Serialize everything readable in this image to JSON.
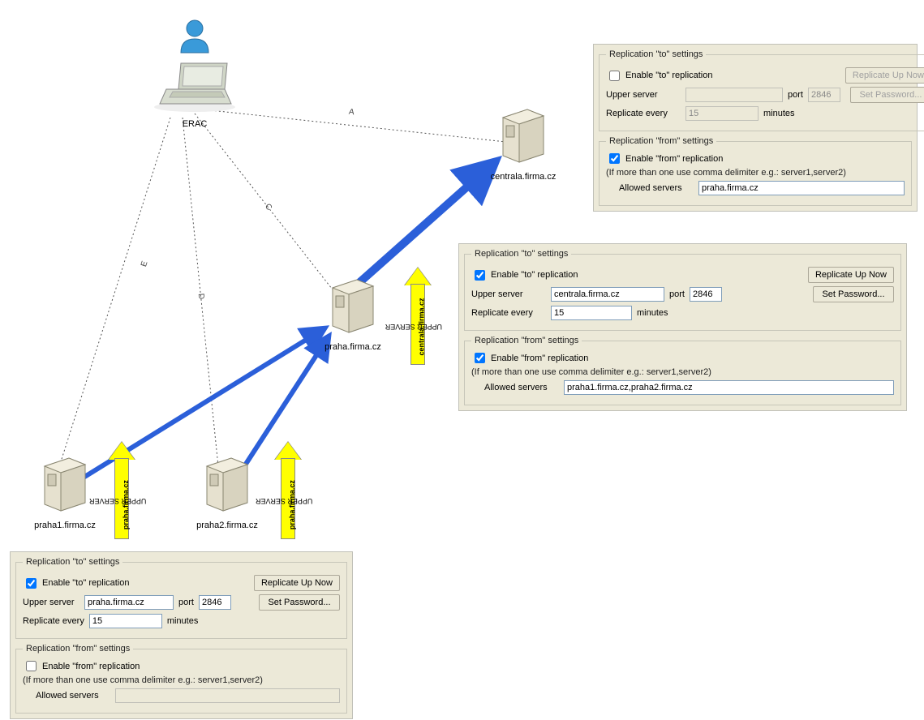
{
  "nodes": {
    "erac": {
      "label": "ERAC"
    },
    "centrala": {
      "label": "centrala.firma.cz"
    },
    "praha": {
      "label": "praha.firma.cz"
    },
    "praha1": {
      "label": "praha1.firma.cz"
    },
    "praha2": {
      "label": "praha2.firma.cz"
    }
  },
  "edgeLabels": {
    "a": "A",
    "c": "C",
    "d": "D",
    "e": "E"
  },
  "upperArrows": {
    "toCentrala": {
      "title": "UPPER SERVER",
      "target": "centrala.firma.cz"
    },
    "toPraha1": {
      "title": "UPPER SERVER",
      "target": "praha.firma.cz"
    },
    "toPraha2": {
      "title": "UPPER SERVER",
      "target": "praha.firma.cz"
    }
  },
  "panels": {
    "centrala": {
      "to": {
        "legend": "Replication \"to\" settings",
        "enableLabel": "Enable \"to\" replication",
        "enabled": false,
        "upperLabel": "Upper server",
        "upperValue": "",
        "portLabel": "port",
        "portValue": "2846",
        "everyLabel": "Replicate every",
        "everyValue": "15",
        "minutesLabel": "minutes",
        "btnReplicate": "Replicate Up Now",
        "btnPassword": "Set Password...",
        "buttonsDisabled": true,
        "inputsDisabled": true
      },
      "from": {
        "legend": "Replication \"from\" settings",
        "enableLabel": "Enable \"from\" replication",
        "enabled": true,
        "hint": "(If more than one use comma delimiter e.g.: server1,server2)",
        "allowedLabel": "Allowed servers",
        "allowedValue": "praha.firma.cz"
      }
    },
    "praha": {
      "to": {
        "legend": "Replication \"to\" settings",
        "enableLabel": "Enable \"to\" replication",
        "enabled": true,
        "upperLabel": "Upper server",
        "upperValue": "centrala.firma.cz",
        "portLabel": "port",
        "portValue": "2846",
        "everyLabel": "Replicate every",
        "everyValue": "15",
        "minutesLabel": "minutes",
        "btnReplicate": "Replicate Up Now",
        "btnPassword": "Set Password...",
        "buttonsDisabled": false,
        "inputsDisabled": false
      },
      "from": {
        "legend": "Replication \"from\" settings",
        "enableLabel": "Enable \"from\" replication",
        "enabled": true,
        "hint": "(If more than one use comma delimiter e.g.: server1,server2)",
        "allowedLabel": "Allowed servers",
        "allowedValue": "praha1.firma.cz,praha2.firma.cz"
      }
    },
    "leaf": {
      "to": {
        "legend": "Replication \"to\" settings",
        "enableLabel": "Enable \"to\" replication",
        "enabled": true,
        "upperLabel": "Upper server",
        "upperValue": "praha.firma.cz",
        "portLabel": "port",
        "portValue": "2846",
        "everyLabel": "Replicate every",
        "everyValue": "15",
        "minutesLabel": "minutes",
        "btnReplicate": "Replicate Up Now",
        "btnPassword": "Set Password...",
        "buttonsDisabled": false,
        "inputsDisabled": false
      },
      "from": {
        "legend": "Replication \"from\" settings",
        "enableLabel": "Enable \"from\" replication",
        "enabled": false,
        "hint": "(If more than one use comma delimiter e.g.: server1,server2)",
        "allowedLabel": "Allowed servers",
        "allowedValue": ""
      }
    }
  }
}
